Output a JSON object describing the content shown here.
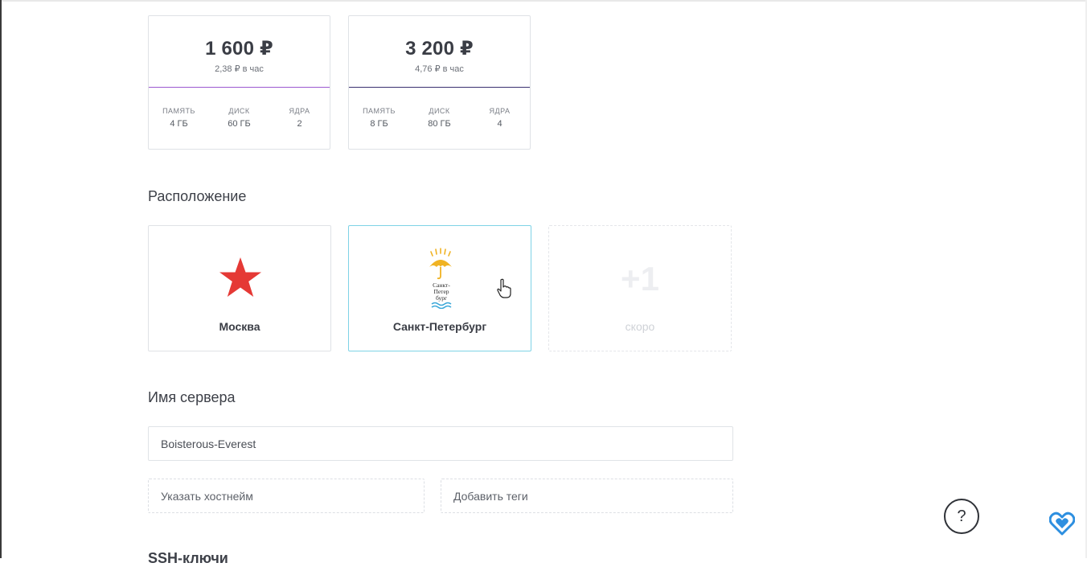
{
  "plans": [
    {
      "price": "1 600 ₽",
      "hourly": "2,38 ₽ в час",
      "accent": "#9b59d0",
      "specs": [
        {
          "label": "ПАМЯТЬ",
          "value": "4 ГБ"
        },
        {
          "label": "ДИСК",
          "value": "60 ГБ"
        },
        {
          "label": "ЯДРА",
          "value": "2"
        }
      ]
    },
    {
      "price": "3 200 ₽",
      "hourly": "4,76 ₽ в час",
      "accent": "#3a3070",
      "specs": [
        {
          "label": "ПАМЯТЬ",
          "value": "8 ГБ"
        },
        {
          "label": "ДИСК",
          "value": "80 ГБ"
        },
        {
          "label": "ЯДРА",
          "value": "4"
        }
      ]
    }
  ],
  "location": {
    "title": "Расположение",
    "cards": [
      {
        "name": "Москва",
        "icon": "red-star-icon",
        "color": "#e53935"
      },
      {
        "name": "Санкт-Петербург",
        "icon": "saint-petersburg-logo",
        "color": "#f0b323",
        "selected": true,
        "logo_text": [
          "Санкт-",
          "Петер",
          "бург"
        ]
      },
      {
        "badge": "+1",
        "note": "скоро"
      }
    ]
  },
  "server": {
    "title": "Имя сервера",
    "name_value": "Boisterous-Everest",
    "hostname_label": "Указать хостнейм",
    "tags_label": "Добавить теги"
  },
  "next_section_title": "SSH-ключи",
  "help": {
    "label": "?"
  },
  "colors": {
    "selected_border": "#7fd3e6",
    "brand": "#2d8fe0"
  }
}
